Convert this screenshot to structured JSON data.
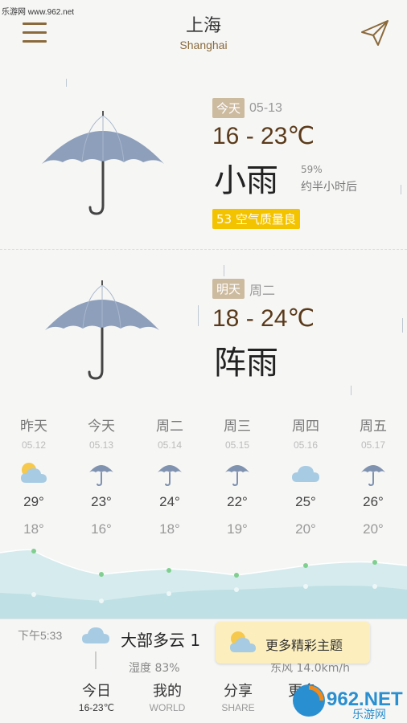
{
  "watermark": "乐游网 www.962.net",
  "header": {
    "city_cn": "上海",
    "city_en": "Shanghai"
  },
  "today": {
    "tag": "今天",
    "date": "05-13",
    "temp": "16 - 23℃",
    "condition": "小雨",
    "humidity": "59%",
    "rain_time": "约半小时后",
    "aqi": "53 空气质量良"
  },
  "tomorrow": {
    "tag": "明天",
    "weekday": "周二",
    "temp": "18 - 24℃",
    "condition": "阵雨"
  },
  "forecast": [
    {
      "name": "昨天",
      "date": "05.12",
      "icon": "partly-cloudy-icon",
      "high": "29°",
      "low": "18°"
    },
    {
      "name": "今天",
      "date": "05.13",
      "icon": "umbrella-icon",
      "high": "23°",
      "low": "16°"
    },
    {
      "name": "周二",
      "date": "05.14",
      "icon": "umbrella-icon",
      "high": "24°",
      "low": "18°"
    },
    {
      "name": "周三",
      "date": "05.15",
      "icon": "umbrella-icon",
      "high": "22°",
      "low": "19°"
    },
    {
      "name": "周四",
      "date": "05.16",
      "icon": "cloud-icon",
      "high": "25°",
      "low": "20°"
    },
    {
      "name": "周五",
      "date": "05.17",
      "icon": "umbrella-icon",
      "high": "26°",
      "low": "20°"
    }
  ],
  "hourly": {
    "time": "下午5:33",
    "condition": "大部多云 1",
    "humidity": "湿度 83%",
    "wind": "东风 14.0km/h"
  },
  "promo": {
    "text": "更多精彩主题"
  },
  "nav": [
    {
      "label": "今日",
      "sub": "16-23℃"
    },
    {
      "label": "我的",
      "sub": "WORLD"
    },
    {
      "label": "分享",
      "sub": "SHARE"
    },
    {
      "label": "更多",
      "sub": ""
    }
  ],
  "logo": {
    "brand": "962.NET",
    "sub": "乐游网"
  },
  "colors": {
    "accent_brown": "#8a6a3c",
    "aqi_yellow": "#f4c300",
    "tag_beige": "#cdbba0"
  }
}
